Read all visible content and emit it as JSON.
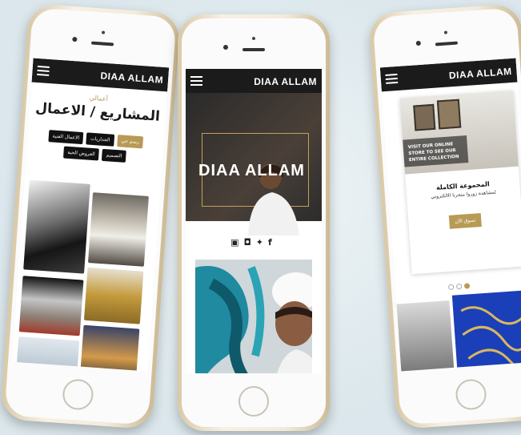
{
  "brand": "DIAA ALLAM",
  "left_phone": {
    "subtitle": "أعمالي",
    "heading": "المشاريع / الاعمال",
    "tags": [
      "الاعمال الفنية",
      "الجداريات",
      "رسم حي",
      "العروض الحية",
      "التصميم"
    ],
    "active_tag": "رسم حي"
  },
  "middle_phone": {
    "hero_text": "DIAA ALLAM",
    "social_icons": [
      "youtube-icon",
      "instagram-icon",
      "twitter-icon",
      "facebook-icon"
    ],
    "social_glyphs": "▣◘✦f"
  },
  "right_phone": {
    "store_text": "VISIT OUR ONLINE STORE TO SEE OUR ENTIRE COLLECTION",
    "card_title": "المجموعة الكاملة",
    "card_subtitle": "لمشاهدة زوروا متجرنا الالكتروني",
    "shop_button": "تسوق الآن",
    "active_dot": 3
  },
  "colors": {
    "accent_gold": "#b89a55",
    "bar_dark": "#1b1b1b"
  }
}
